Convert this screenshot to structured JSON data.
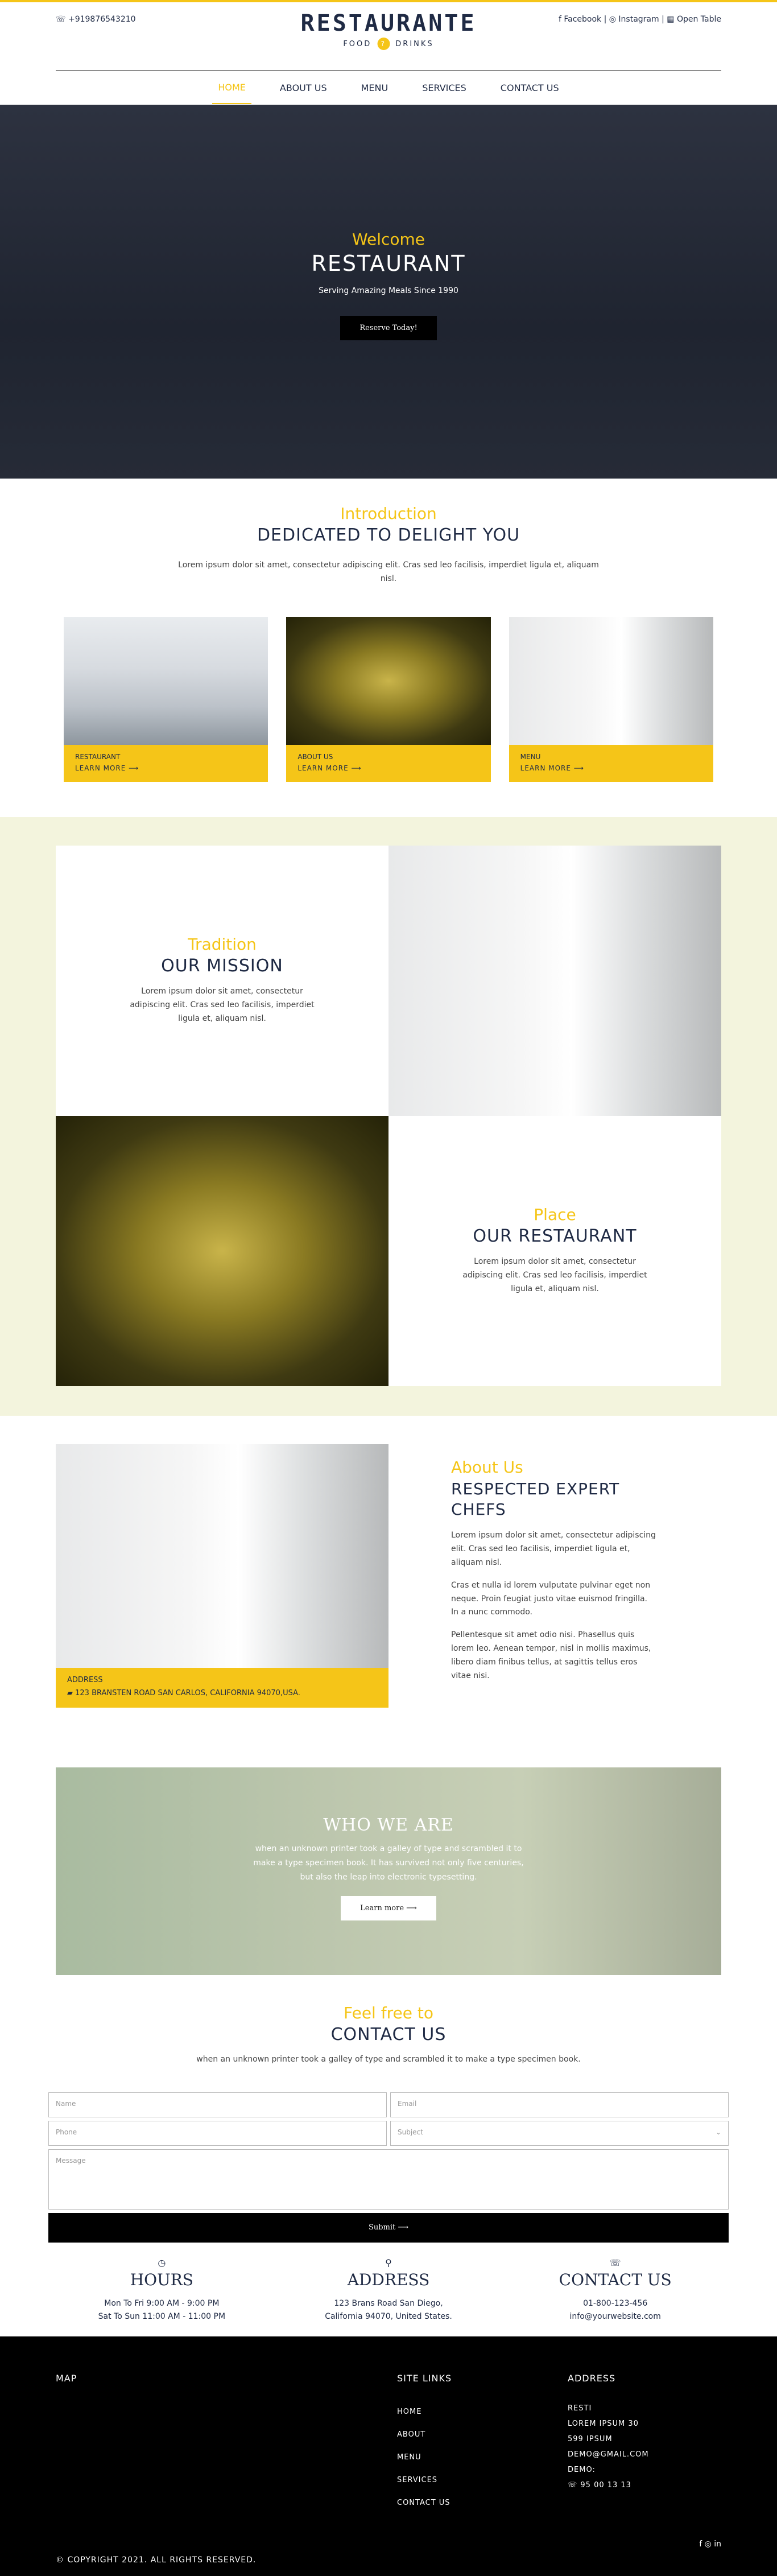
{
  "header": {
    "phone": "☏ +919876543210",
    "logo_title": "RESTAURANTE",
    "logo_left": "FOOD",
    "logo_icon": "?",
    "logo_right": "DRINKS",
    "social": [
      "f Facebook |",
      "◎ Instagram |",
      "▦ Open Table"
    ]
  },
  "nav": {
    "home": "HOME",
    "about": "ABOUT US",
    "menu": "MENU",
    "services": "SERVICES",
    "contact": "CONTACT US"
  },
  "hero": {
    "welcome": "Welcome",
    "title": "RESTAURANT",
    "subtitle": "Serving Amazing Meals Since 1990",
    "button": "Reserve Today!"
  },
  "intro": {
    "kicker": "Introduction",
    "title": "DEDICATED TO DELIGHT YOU",
    "text": "Lorem ipsum dolor sit amet, consectetur adipiscing elit. Cras sed leo facilisis, imperdiet ligula et, aliquam nisl.",
    "cards": [
      {
        "label": "RESTAURANT",
        "cta": "LEARN MORE ⟶"
      },
      {
        "label": "ABOUT US",
        "cta": "LEARN MORE ⟶"
      },
      {
        "label": "MENU",
        "cta": "LEARN MORE ⟶"
      }
    ]
  },
  "mission": {
    "kicker": "Tradition",
    "title": "OUR MISSION",
    "text": "Lorem ipsum dolor sit amet, consectetur adipiscing elit. Cras sed leo facilisis, imperdiet ligula et, aliquam nisl."
  },
  "place": {
    "kicker": "Place",
    "title": "OUR RESTAURANT",
    "text": "Lorem ipsum dolor sit amet, consectetur adipiscing elit. Cras sed leo facilisis, imperdiet ligula et, aliquam nisl."
  },
  "about": {
    "kicker": "About Us",
    "title": "RESPECTED EXPERT CHEFS",
    "p1": "Lorem ipsum dolor sit amet, consectetur adipiscing elit. Cras sed leo facilisis, imperdiet ligula et, aliquam nisl.",
    "p2": "Cras et nulla id lorem vulputate pulvinar eget non neque. Proin feugiat justo vitae euismod fringilla. In a nunc commodo.",
    "p3": "Pellentesque sit amet odio nisi. Phasellus quis lorem leo. Aenean tempor, nisl in mollis maximus, libero diam finibus tellus, at sagittis tellus eros vitae nisi.",
    "address_label": "ADDRESS",
    "address": "▰ 123 BRANSTEN ROAD SAN CARLOS, CALIFORNIA 94070,USA."
  },
  "who": {
    "title": "WHO WE ARE",
    "text": "when an unknown printer took a galley of type and scrambled it to make a type specimen book. It has survived not only five centuries, but also the leap into electronic typesetting.",
    "button": "Learn more ⟶"
  },
  "contact": {
    "kicker": "Feel free to",
    "title": "CONTACT US",
    "text": "when an unknown printer took a galley of type and scrambled it to make a type specimen book.",
    "name_ph": "Name",
    "email_ph": "Email",
    "phone_ph": "Phone",
    "subject_ph": "Subject",
    "message_ph": "Message",
    "submit": "Submit ⟶"
  },
  "info": {
    "hours_icon": "◷",
    "hours_title": "HOURS",
    "hours_1": "Mon To Fri 9:00 AM - 9:00 PM",
    "hours_2": "Sat To Sun 11:00 AM - 11:00 PM",
    "addr_icon": "⚲",
    "addr_title": "ADDRESS",
    "addr_1": "123 Brans Road San Diego,",
    "addr_2": "California 94070, United States.",
    "contact_icon": "☏",
    "contact_title": "CONTACT US",
    "contact_1": "01-800-123-456",
    "contact_2": "info@yourwebsite.com"
  },
  "footer": {
    "map": "MAP",
    "links_title": "SITE LINKS",
    "links": [
      "HOME",
      "ABOUT",
      "MENU",
      "SERVICES",
      "CONTACT US"
    ],
    "addr_title": "ADDRESS",
    "addr_lines": [
      "RESTI",
      "LOREM IPSUM 30",
      "599 IPSUM",
      "DEMO@GMAIL.COM",
      "DEMO:",
      "☏ 95 00 13 13"
    ],
    "social": "f ◎ in",
    "copyright": "© COPYRIGHT 2021. ALL RIGHTS RESERVED."
  },
  "colors": {
    "accent": "#f5c518",
    "navy": "#1f2a44",
    "cream": "#f3f4dd"
  }
}
